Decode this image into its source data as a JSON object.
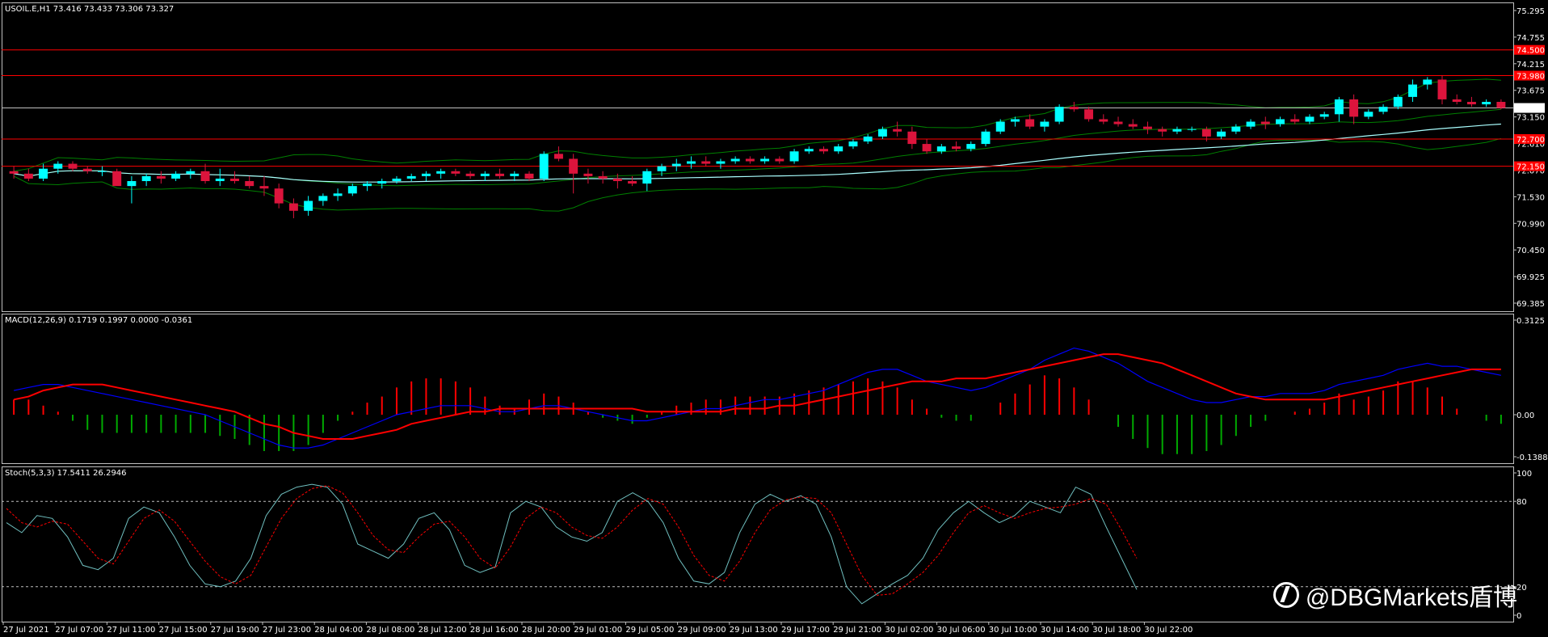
{
  "symbol_header": "USOIL.E,H1  73.416 73.433 73.306 73.327",
  "macd_header": "MACD(12,26,9) 0.1719 0.1997 0.0000 -0.0361",
  "stoch_header": "Stoch(5,3,3) 17.5411 26.2946",
  "watermark": "@DBGMarkets盾博",
  "price_axis": [
    "75.295",
    "74.755",
    "74.215",
    "73.675",
    "73.150",
    "72.610",
    "72.070",
    "71.530",
    "70.990",
    "70.450",
    "69.925",
    "69.385"
  ],
  "macd_axis": [
    "0.3125",
    "0.00",
    "-0.1388"
  ],
  "stoch_axis": [
    "100",
    "80",
    "20",
    "0"
  ],
  "time_axis": [
    "27 Jul 2021",
    "27 Jul 07:00",
    "27 Jul 11:00",
    "27 Jul 15:00",
    "27 Jul 19:00",
    "27 Jul 23:00",
    "28 Jul 04:00",
    "28 Jul 08:00",
    "28 Jul 12:00",
    "28 Jul 16:00",
    "28 Jul 20:00",
    "29 Jul 01:00",
    "29 Jul 05:00",
    "29 Jul 09:00",
    "29 Jul 13:00",
    "29 Jul 17:00",
    "29 Jul 21:00",
    "30 Jul 02:00",
    "30 Jul 06:00",
    "30 Jul 10:00",
    "30 Jul 14:00",
    "30 Jul 18:00",
    "30 Jul 22:00"
  ],
  "horizontal_levels": [
    {
      "price": 74.5,
      "label": "74.500",
      "color": "#ff0000"
    },
    {
      "price": 73.98,
      "label": "73.980",
      "color": "#ff0000"
    },
    {
      "price": 73.327,
      "label": "73.327",
      "color": "#c0c0c0"
    },
    {
      "price": 72.7,
      "label": "72.700",
      "color": "#ff0000"
    },
    {
      "price": 72.15,
      "label": "72.150",
      "color": "#ff0000"
    }
  ],
  "colors": {
    "bull": "#00ffff",
    "bear": "#dc143c",
    "bands": "#008000",
    "ma": "#aaffff",
    "macd_line": "#0000ff",
    "signal_line": "#ff0000",
    "hist_pos": "#ff0000",
    "hist_neg": "#00aa00",
    "stoch_main": "#70c0c0",
    "stoch_signal": "#ff0000"
  },
  "chart_data": {
    "type": "candlestick",
    "price_range": [
      69.385,
      75.295
    ],
    "candles": [
      [
        72.05,
        72.15,
        71.9,
        72.0
      ],
      [
        72.0,
        72.1,
        71.85,
        71.9
      ],
      [
        71.9,
        72.2,
        71.85,
        72.1
      ],
      [
        72.1,
        72.25,
        72.0,
        72.2
      ],
      [
        72.2,
        72.25,
        72.05,
        72.1
      ],
      [
        72.1,
        72.15,
        72.0,
        72.05
      ],
      [
        72.05,
        72.15,
        71.95,
        72.05
      ],
      [
        72.05,
        72.1,
        71.8,
        71.75
      ],
      [
        71.75,
        71.95,
        71.4,
        71.85
      ],
      [
        71.85,
        72.0,
        71.75,
        71.95
      ],
      [
        71.95,
        72.05,
        71.8,
        71.9
      ],
      [
        71.9,
        72.05,
        71.85,
        72.0
      ],
      [
        72.0,
        72.1,
        71.9,
        72.05
      ],
      [
        72.05,
        72.2,
        71.8,
        71.85
      ],
      [
        71.85,
        72.1,
        71.75,
        71.9
      ],
      [
        71.9,
        72.05,
        71.8,
        71.85
      ],
      [
        71.85,
        71.95,
        71.7,
        71.75
      ],
      [
        71.75,
        71.95,
        71.55,
        71.7
      ],
      [
        71.7,
        71.8,
        71.3,
        71.4
      ],
      [
        71.4,
        71.5,
        71.1,
        71.25
      ],
      [
        71.25,
        71.55,
        71.15,
        71.45
      ],
      [
        71.45,
        71.6,
        71.35,
        71.55
      ],
      [
        71.55,
        71.7,
        71.45,
        71.6
      ],
      [
        71.6,
        71.8,
        71.55,
        71.75
      ],
      [
        71.75,
        71.85,
        71.65,
        71.8
      ],
      [
        71.8,
        71.9,
        71.7,
        71.85
      ],
      [
        71.85,
        71.95,
        71.8,
        71.9
      ],
      [
        71.9,
        72.0,
        71.85,
        71.95
      ],
      [
        71.95,
        72.05,
        71.85,
        72.0
      ],
      [
        72.0,
        72.1,
        71.9,
        72.05
      ],
      [
        72.05,
        72.1,
        71.95,
        72.0
      ],
      [
        72.0,
        72.05,
        71.9,
        71.95
      ],
      [
        71.95,
        72.05,
        71.85,
        72.0
      ],
      [
        72.0,
        72.1,
        71.9,
        71.95
      ],
      [
        71.95,
        72.05,
        71.85,
        72.0
      ],
      [
        72.0,
        72.05,
        71.85,
        71.9
      ],
      [
        71.9,
        72.45,
        71.85,
        72.4
      ],
      [
        72.4,
        72.55,
        72.25,
        72.3
      ],
      [
        72.3,
        72.4,
        71.6,
        72.0
      ],
      [
        72.0,
        72.1,
        71.8,
        71.95
      ],
      [
        71.95,
        72.05,
        71.8,
        71.9
      ],
      [
        71.9,
        72.0,
        71.7,
        71.85
      ],
      [
        71.85,
        71.95,
        71.75,
        71.8
      ],
      [
        71.8,
        72.1,
        71.65,
        72.05
      ],
      [
        72.05,
        72.2,
        71.95,
        72.15
      ],
      [
        72.15,
        72.3,
        72.05,
        72.2
      ],
      [
        72.2,
        72.35,
        72.1,
        72.25
      ],
      [
        72.25,
        72.35,
        72.15,
        72.2
      ],
      [
        72.2,
        72.3,
        72.1,
        72.25
      ],
      [
        72.25,
        72.35,
        72.2,
        72.3
      ],
      [
        72.3,
        72.35,
        72.2,
        72.25
      ],
      [
        72.25,
        72.35,
        72.2,
        72.3
      ],
      [
        72.3,
        72.35,
        72.2,
        72.25
      ],
      [
        72.25,
        72.5,
        72.2,
        72.45
      ],
      [
        72.45,
        72.55,
        72.4,
        72.5
      ],
      [
        72.5,
        72.55,
        72.4,
        72.45
      ],
      [
        72.45,
        72.6,
        72.4,
        72.55
      ],
      [
        72.55,
        72.7,
        72.5,
        72.65
      ],
      [
        72.65,
        72.8,
        72.6,
        72.75
      ],
      [
        72.75,
        72.95,
        72.7,
        72.9
      ],
      [
        72.9,
        73.05,
        72.75,
        72.85
      ],
      [
        72.85,
        72.95,
        72.5,
        72.6
      ],
      [
        72.6,
        72.7,
        72.4,
        72.45
      ],
      [
        72.45,
        72.6,
        72.4,
        72.55
      ],
      [
        72.55,
        72.65,
        72.45,
        72.5
      ],
      [
        72.5,
        72.65,
        72.45,
        72.6
      ],
      [
        72.6,
        72.9,
        72.55,
        72.85
      ],
      [
        72.85,
        73.1,
        72.8,
        73.05
      ],
      [
        73.05,
        73.15,
        72.95,
        73.1
      ],
      [
        73.1,
        73.2,
        72.9,
        72.95
      ],
      [
        72.95,
        73.1,
        72.85,
        73.05
      ],
      [
        73.05,
        73.4,
        73.0,
        73.35
      ],
      [
        73.35,
        73.45,
        73.25,
        73.3
      ],
      [
        73.3,
        73.35,
        73.05,
        73.1
      ],
      [
        73.1,
        73.2,
        73.0,
        73.05
      ],
      [
        73.05,
        73.15,
        72.95,
        73.0
      ],
      [
        73.0,
        73.1,
        72.9,
        72.95
      ],
      [
        72.95,
        73.05,
        72.8,
        72.9
      ],
      [
        72.9,
        72.95,
        72.75,
        72.85
      ],
      [
        72.85,
        72.95,
        72.8,
        72.9
      ],
      [
        72.9,
        72.95,
        72.85,
        72.9
      ],
      [
        72.9,
        72.95,
        72.65,
        72.75
      ],
      [
        72.75,
        72.9,
        72.7,
        72.85
      ],
      [
        72.85,
        73.0,
        72.8,
        72.95
      ],
      [
        72.95,
        73.1,
        72.9,
        73.05
      ],
      [
        73.05,
        73.15,
        72.9,
        73.0
      ],
      [
        73.0,
        73.15,
        72.95,
        73.1
      ],
      [
        73.1,
        73.2,
        73.0,
        73.05
      ],
      [
        73.05,
        73.2,
        73.0,
        73.15
      ],
      [
        73.15,
        73.25,
        73.1,
        73.2
      ],
      [
        73.2,
        73.55,
        73.05,
        73.5
      ],
      [
        73.5,
        73.6,
        73.0,
        73.15
      ],
      [
        73.15,
        73.3,
        73.1,
        73.25
      ],
      [
        73.25,
        73.4,
        73.2,
        73.35
      ],
      [
        73.35,
        73.6,
        73.3,
        73.55
      ],
      [
        73.55,
        73.9,
        73.45,
        73.8
      ],
      [
        73.8,
        73.95,
        73.7,
        73.9
      ],
      [
        73.9,
        73.98,
        73.4,
        73.5
      ],
      [
        73.5,
        73.6,
        73.4,
        73.45
      ],
      [
        73.45,
        73.55,
        73.35,
        73.4
      ],
      [
        73.4,
        73.5,
        73.35,
        73.45
      ],
      [
        73.45,
        73.5,
        73.3,
        73.327
      ]
    ],
    "macd_range": [
      -0.1388,
      0.3125
    ],
    "macd_hist": [
      0.05,
      0.05,
      0.03,
      0.01,
      -0.02,
      -0.05,
      -0.06,
      -0.06,
      -0.06,
      -0.06,
      -0.06,
      -0.06,
      -0.06,
      -0.06,
      -0.07,
      -0.08,
      -0.1,
      -0.12,
      -0.12,
      -0.12,
      -0.1,
      -0.06,
      -0.02,
      0.01,
      0.04,
      0.06,
      0.09,
      0.11,
      0.12,
      0.12,
      0.11,
      0.09,
      0.06,
      0.03,
      0.02,
      0.05,
      0.07,
      0.06,
      0.04,
      0.01,
      -0.01,
      -0.02,
      -0.03,
      -0.01,
      0.01,
      0.03,
      0.04,
      0.05,
      0.05,
      0.06,
      0.06,
      0.06,
      0.06,
      0.07,
      0.08,
      0.09,
      0.1,
      0.11,
      0.12,
      0.11,
      0.09,
      0.05,
      0.02,
      -0.01,
      -0.02,
      -0.02,
      0.0,
      0.04,
      0.07,
      0.1,
      0.13,
      0.12,
      0.09,
      0.05,
      0.0,
      -0.04,
      -0.08,
      -0.11,
      -0.13,
      -0.13,
      -0.13,
      -0.12,
      -0.1,
      -0.07,
      -0.04,
      -0.02,
      0.0,
      0.01,
      0.02,
      0.04,
      0.07,
      0.05,
      0.06,
      0.08,
      0.11,
      0.11,
      0.09,
      0.06,
      0.02,
      0.0,
      -0.02,
      -0.03
    ],
    "macd_line": [
      0.08,
      0.09,
      0.1,
      0.1,
      0.09,
      0.08,
      0.07,
      0.06,
      0.05,
      0.04,
      0.03,
      0.02,
      0.01,
      0.0,
      -0.02,
      -0.04,
      -0.06,
      -0.08,
      -0.1,
      -0.11,
      -0.11,
      -0.1,
      -0.08,
      -0.06,
      -0.04,
      -0.02,
      0.0,
      0.01,
      0.02,
      0.03,
      0.03,
      0.03,
      0.02,
      0.01,
      0.01,
      0.02,
      0.03,
      0.03,
      0.02,
      0.01,
      0.0,
      -0.01,
      -0.02,
      -0.02,
      -0.01,
      0.0,
      0.01,
      0.02,
      0.02,
      0.03,
      0.04,
      0.05,
      0.05,
      0.06,
      0.07,
      0.08,
      0.1,
      0.12,
      0.14,
      0.15,
      0.15,
      0.13,
      0.11,
      0.1,
      0.09,
      0.08,
      0.09,
      0.11,
      0.13,
      0.15,
      0.18,
      0.2,
      0.22,
      0.21,
      0.19,
      0.17,
      0.14,
      0.11,
      0.09,
      0.07,
      0.05,
      0.04,
      0.04,
      0.05,
      0.06,
      0.06,
      0.07,
      0.07,
      0.07,
      0.08,
      0.1,
      0.11,
      0.12,
      0.13,
      0.15,
      0.16,
      0.17,
      0.16,
      0.16,
      0.15,
      0.14,
      0.13
    ],
    "signal_line": [
      0.05,
      0.06,
      0.08,
      0.09,
      0.1,
      0.1,
      0.1,
      0.09,
      0.08,
      0.07,
      0.06,
      0.05,
      0.04,
      0.03,
      0.02,
      0.01,
      -0.01,
      -0.03,
      -0.04,
      -0.06,
      -0.07,
      -0.08,
      -0.08,
      -0.08,
      -0.07,
      -0.06,
      -0.05,
      -0.03,
      -0.02,
      -0.01,
      0.0,
      0.01,
      0.01,
      0.02,
      0.02,
      0.02,
      0.02,
      0.02,
      0.02,
      0.02,
      0.02,
      0.02,
      0.02,
      0.01,
      0.01,
      0.01,
      0.01,
      0.01,
      0.01,
      0.02,
      0.02,
      0.02,
      0.03,
      0.03,
      0.04,
      0.05,
      0.06,
      0.07,
      0.08,
      0.09,
      0.1,
      0.11,
      0.11,
      0.11,
      0.12,
      0.12,
      0.12,
      0.13,
      0.14,
      0.15,
      0.16,
      0.17,
      0.18,
      0.19,
      0.2,
      0.2,
      0.19,
      0.18,
      0.17,
      0.15,
      0.13,
      0.11,
      0.09,
      0.07,
      0.06,
      0.05,
      0.05,
      0.05,
      0.05,
      0.05,
      0.06,
      0.07,
      0.08,
      0.09,
      0.1,
      0.11,
      0.12,
      0.13,
      0.14,
      0.15,
      0.15,
      0.15
    ],
    "stoch_main": [
      65,
      58,
      70,
      68,
      55,
      35,
      32,
      40,
      68,
      76,
      72,
      55,
      35,
      22,
      20,
      24,
      40,
      70,
      85,
      90,
      92,
      90,
      78,
      50,
      45,
      40,
      50,
      68,
      72,
      60,
      35,
      30,
      34,
      72,
      80,
      76,
      62,
      55,
      52,
      58,
      80,
      86,
      80,
      65,
      40,
      24,
      22,
      30,
      58,
      78,
      85,
      80,
      84,
      78,
      55,
      20,
      8,
      15,
      22,
      28,
      40,
      60,
      72,
      80,
      72,
      65,
      70,
      80,
      76,
      72,
      90,
      85,
      62,
      40,
      18
    ],
    "stoch_signal": [
      75,
      65,
      62,
      66,
      64,
      52,
      40,
      36,
      52,
      68,
      74,
      66,
      52,
      38,
      27,
      22,
      28,
      48,
      68,
      82,
      89,
      91,
      86,
      72,
      56,
      46,
      44,
      55,
      64,
      66,
      55,
      40,
      33,
      48,
      68,
      76,
      72,
      62,
      56,
      54,
      62,
      74,
      82,
      78,
      62,
      42,
      28,
      24,
      38,
      58,
      74,
      81,
      83,
      82,
      72,
      50,
      28,
      14,
      15,
      22,
      30,
      42,
      58,
      72,
      77,
      72,
      68,
      72,
      75,
      76,
      78,
      82,
      78,
      60,
      40
    ]
  }
}
